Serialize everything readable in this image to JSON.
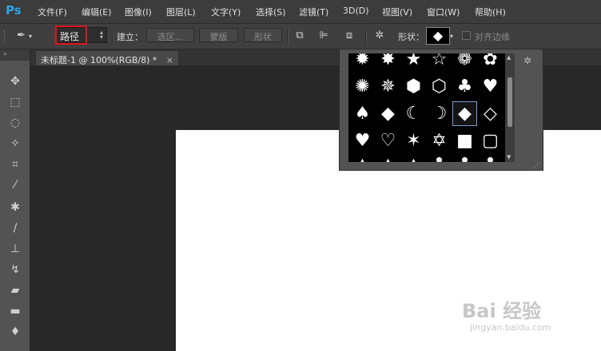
{
  "app": {
    "logo": "Ps"
  },
  "menu": [
    "文件(F)",
    "编辑(E)",
    "图像(I)",
    "图层(L)",
    "文字(Y)",
    "选择(S)",
    "滤镜(T)",
    "3D(D)",
    "视图(V)",
    "窗口(W)",
    "帮助(H)"
  ],
  "options": {
    "mode_value": "路径",
    "make_label": "建立：",
    "selection_button": "选区...",
    "mask_button": "蒙版",
    "shape_button": "形状",
    "shape_label": "形状：",
    "align_edges_label": "对齐边缘",
    "align_edges_checked": false,
    "current_shape": "◆"
  },
  "document": {
    "tab_title": "未标题-1 @ 100%(RGB/8) *",
    "tab_close": "×"
  },
  "shape_picker": {
    "rows": [
      [
        "✹",
        "✸",
        "★",
        "☆",
        "❁",
        "✿"
      ],
      [
        "✺",
        "✵",
        "⬢",
        "⬡",
        "♣",
        "♥"
      ],
      [
        "♠",
        "◆",
        "☾",
        "☽",
        "◆",
        "◇"
      ],
      [
        "♥",
        "♡",
        "✶",
        "✡",
        "■",
        "▢"
      ],
      [
        "▲",
        "▲",
        "▲",
        "♣",
        "♣",
        "♣"
      ]
    ],
    "selected": "row2-col4"
  },
  "watermark": {
    "main": "Bai 经验",
    "sub": "jingyan.baidu.com"
  },
  "colors": {
    "accent": "#2fa3e6",
    "highlight": "#e0151b",
    "selection": "#7d9ad6"
  }
}
